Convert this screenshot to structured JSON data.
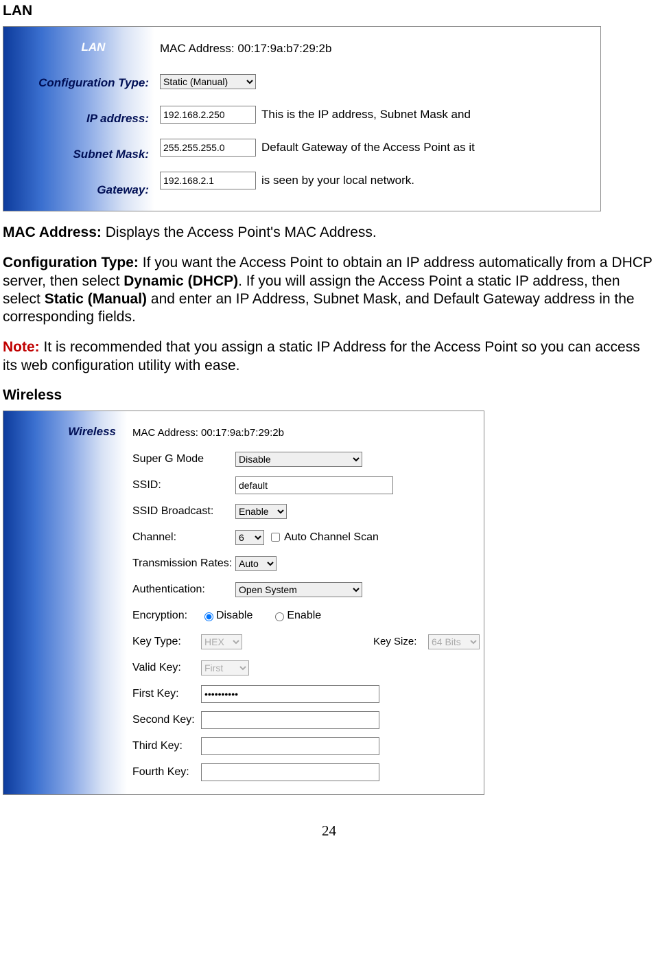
{
  "doc": {
    "lan_heading": "LAN",
    "wireless_heading": "Wireless",
    "page_number": "24",
    "mac_desc_label": "MAC Address:",
    "mac_desc_text": " Displays the Access Point's MAC Address.",
    "cfg_desc_label": "Configuration Type:",
    "cfg_desc_1": " If you want the Access Point to obtain an IP address automatically from a DHCP server, then select ",
    "cfg_desc_bold1": "Dynamic (DHCP)",
    "cfg_desc_2": ". If you will assign the Access Point a static IP address, then select ",
    "cfg_desc_bold2": "Static (Manual)",
    "cfg_desc_3": " and enter an IP Address, Subnet Mask, and Default Gateway address in the corresponding fields.",
    "note_label": "Note:",
    "note_text": " It is recommended that you assign a static IP Address for the Access Point so you can access its web configuration utility with ease."
  },
  "lan": {
    "sidebar": {
      "title": "LAN",
      "cfg_type": "Configuration Type:",
      "ip": "IP address:",
      "subnet": "Subnet Mask:",
      "gateway": "Gateway:"
    },
    "mac_label": "MAC Address: 00:17:9a:b7:29:2b",
    "cfg_type_value": "Static (Manual)",
    "ip_value": "192.168.2.250",
    "subnet_value": "255.255.255.0",
    "gateway_value": "192.168.2.1",
    "desc1": "This is the IP address, Subnet Mask and",
    "desc2": "Default Gateway of the Access Point as it",
    "desc3": "is seen by your local network."
  },
  "wl": {
    "sidebar": {
      "title": "Wireless"
    },
    "mac_label": "MAC Address: 00:17:9a:b7:29:2b",
    "superg_label": "Super G Mode",
    "superg_value": "Disable",
    "ssid_label": "SSID:",
    "ssid_value": "default",
    "ssid_bcast_label": "SSID Broadcast:",
    "ssid_bcast_value": "Enable",
    "channel_label": "Channel:",
    "channel_value": "6",
    "autoscan_label": " Auto Channel Scan",
    "txrate_label": "Transmission Rates:",
    "txrate_value": "Auto",
    "auth_label": "Authentication:",
    "auth_value": "Open System",
    "enc_label": "Encryption:",
    "enc_disable": "Disable",
    "enc_enable": "Enable",
    "keytype_label": "Key Type:",
    "keytype_value": "HEX",
    "keysize_label": "Key Size:",
    "keysize_value": "64 Bits",
    "validkey_label": "Valid Key:",
    "validkey_value": "First",
    "k1_label": "First Key:",
    "k1_value": "••••••••••",
    "k2_label": "Second Key:",
    "k3_label": "Third Key:",
    "k4_label": "Fourth Key:"
  }
}
